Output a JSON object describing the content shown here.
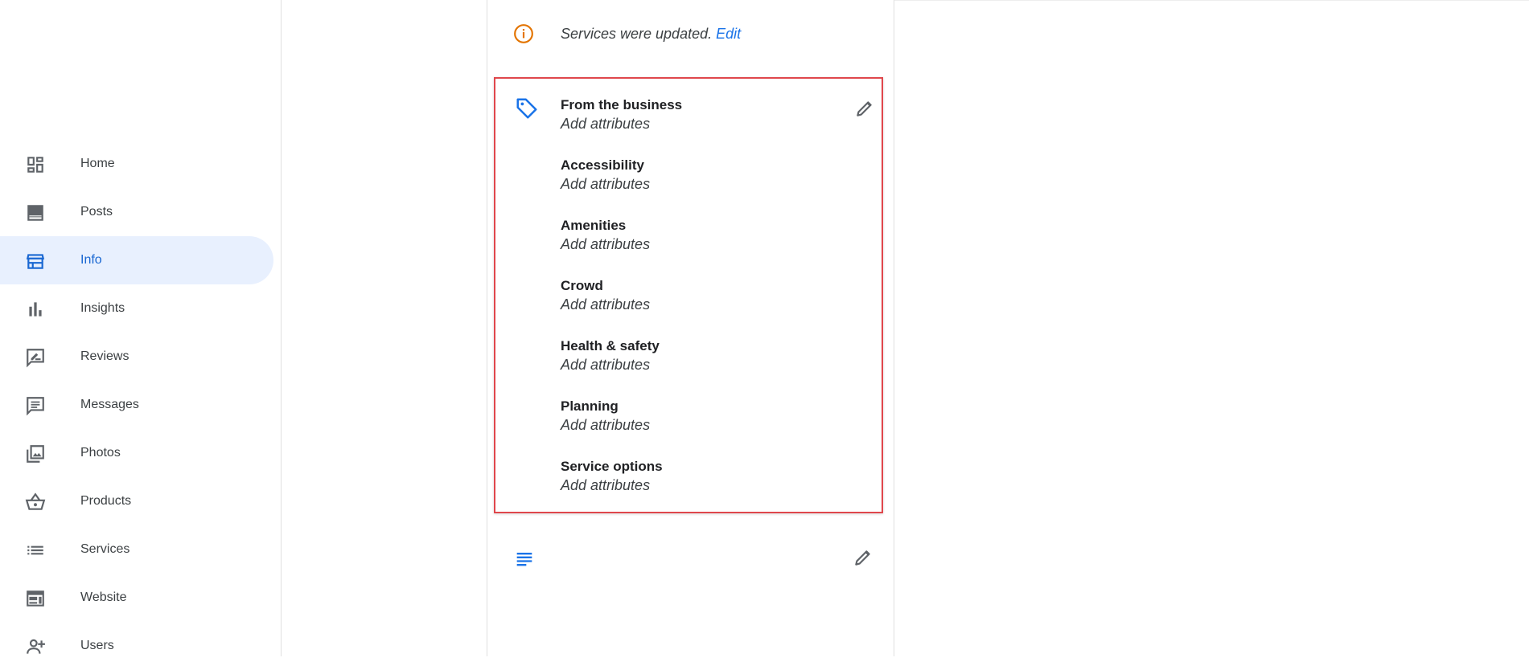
{
  "sidebar": {
    "items": [
      {
        "label": "Home",
        "icon": "dashboard-icon"
      },
      {
        "label": "Posts",
        "icon": "posts-icon"
      },
      {
        "label": "Info",
        "icon": "storefront-icon",
        "active": true
      },
      {
        "label": "Insights",
        "icon": "bar-chart-icon"
      },
      {
        "label": "Reviews",
        "icon": "rate-review-icon"
      },
      {
        "label": "Messages",
        "icon": "message-icon"
      },
      {
        "label": "Photos",
        "icon": "photo-library-icon"
      },
      {
        "label": "Products",
        "icon": "basket-icon"
      },
      {
        "label": "Services",
        "icon": "list-icon"
      },
      {
        "label": "Website",
        "icon": "web-icon"
      },
      {
        "label": "Users",
        "icon": "person-add-icon"
      }
    ]
  },
  "notice": {
    "text": "Services were updated.",
    "edit_label": "Edit",
    "icon": "info-icon",
    "color": "#e37400"
  },
  "attributes": {
    "icon": "tag-icon",
    "items": [
      {
        "title": "From the business",
        "value": "Add attributes"
      },
      {
        "title": "Accessibility",
        "value": "Add attributes"
      },
      {
        "title": "Amenities",
        "value": "Add attributes"
      },
      {
        "title": "Crowd",
        "value": "Add attributes"
      },
      {
        "title": "Health & safety",
        "value": "Add attributes"
      },
      {
        "title": "Planning",
        "value": "Add attributes"
      },
      {
        "title": "Service options",
        "value": "Add attributes"
      }
    ]
  },
  "description": {
    "icon": "subject-icon"
  },
  "colors": {
    "accent": "#1a73e8",
    "active_bg": "#e8f0fe",
    "highlight_border": "#e0474c"
  }
}
